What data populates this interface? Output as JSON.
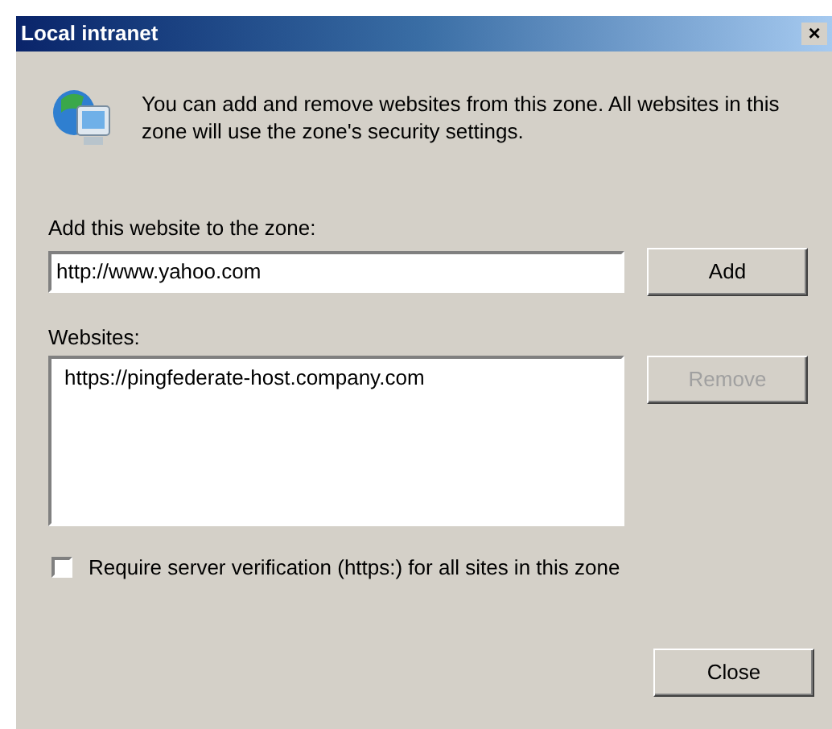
{
  "window": {
    "title": "Local intranet",
    "close_glyph": "×"
  },
  "description": "You can add and remove websites from this zone. All websites in this zone will use the zone's security settings.",
  "add_field": {
    "label": "Add this website to the zone:",
    "value": "http://www.yahoo.com"
  },
  "add_button": {
    "label": "Add",
    "disabled": false
  },
  "websites": {
    "label": "Websites:",
    "items": [
      {
        "text": "https://pingfederate-host.company.com",
        "selected": false
      }
    ]
  },
  "remove_button": {
    "label": "Remove",
    "disabled": true
  },
  "require_verification": {
    "label": "Require server verification (https:) for all sites in this zone",
    "checked": false
  },
  "close_button": {
    "label": "Close",
    "disabled": false
  }
}
